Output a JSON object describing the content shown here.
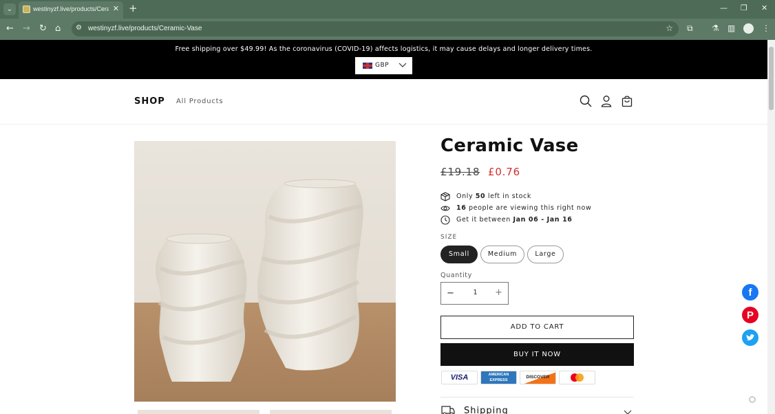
{
  "browser": {
    "tab_title": "westinyzf.live/products/Ceramic-Vase",
    "url": "westinyzf.live/products/Ceramic-Vase",
    "accent": "#5d7a66"
  },
  "announcement": {
    "text": "Free shipping over $49.99! As the coronavirus (COVID-19) affects logistics, it may cause delays and longer delivery times.",
    "currency": "GBP"
  },
  "header": {
    "logo": "SHOP",
    "nav_all_products": "All Products",
    "icons": [
      "search-icon",
      "account-icon",
      "cart-icon"
    ]
  },
  "product": {
    "title": "Ceramic Vase",
    "price_old": "£19.18",
    "price_new": "£0.76",
    "stock_prefix": "Only",
    "stock_count": "50",
    "stock_suffix": "left in stock",
    "viewers_count": "16",
    "viewers_suffix": "people are viewing this right now",
    "delivery_prefix": "Get it between",
    "delivery_range": "Jan 06 - Jan 16",
    "size_label": "SIZE",
    "sizes": [
      "Small",
      "Medium",
      "Large"
    ],
    "selected_size": "Small",
    "quantity_label": "Quantity",
    "quantity": "1",
    "add_to_cart": "ADD TO CART",
    "buy_now": "BUY IT NOW",
    "payments": [
      "VISA",
      "AMERICAN EXPRESS",
      "DISCOVER",
      "mastercard"
    ],
    "shipping_label": "Shipping"
  },
  "social": [
    "facebook-icon",
    "pinterest-icon",
    "twitter-icon"
  ]
}
